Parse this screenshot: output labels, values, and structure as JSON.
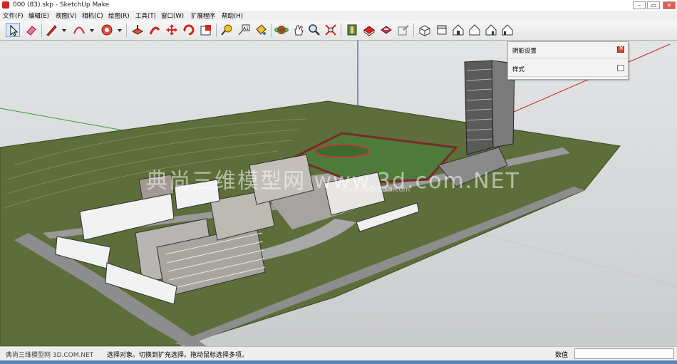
{
  "window": {
    "title": "000 (83).skp - SketchUp Make",
    "controls": {
      "minimize": "–",
      "maximize": "▭",
      "close": "✕"
    }
  },
  "menu": {
    "items": [
      "文件(F)",
      "编辑(E)",
      "视图(V)",
      "相机(C)",
      "绘图(R)",
      "工具(T)",
      "窗口(W)",
      "扩展程序",
      "帮助(H)"
    ]
  },
  "toolbar": {
    "tools": [
      "select-arrow",
      "eraser",
      "line-pencil",
      "arc",
      "shape-circle",
      "push-pull",
      "move",
      "rotate",
      "scale",
      "offset",
      "tape-measure",
      "text-label",
      "paint-bucket",
      "orbit",
      "pan",
      "zoom",
      "zoom-extents",
      "warehouse",
      "components",
      "extension-warehouse",
      "share",
      "iso-view",
      "top-view",
      "front-view",
      "right-view",
      "back-view",
      "left-view"
    ]
  },
  "tray": {
    "panels": [
      {
        "label": "阴影设置"
      },
      {
        "label": "样式"
      }
    ]
  },
  "viewport": {
    "watermark": "典尚三维模型网 www.3d.com.NET",
    "watermark_url": "www.3dsmax8.com"
  },
  "status": {
    "text": "选择对象。切换到扩充选择。拖动鼠标选择多项。",
    "watermark": "典尚三维模型网 3D.COM.NET",
    "vcb_label": "数值",
    "vcb_value": ""
  },
  "colors": {
    "sky": "#dfe1e3",
    "ground": "#5d6e3a",
    "road": "#8d8d8d",
    "axis_red": "#c8281e",
    "axis_green": "#2fa42f",
    "axis_blue": "#2828c8"
  }
}
